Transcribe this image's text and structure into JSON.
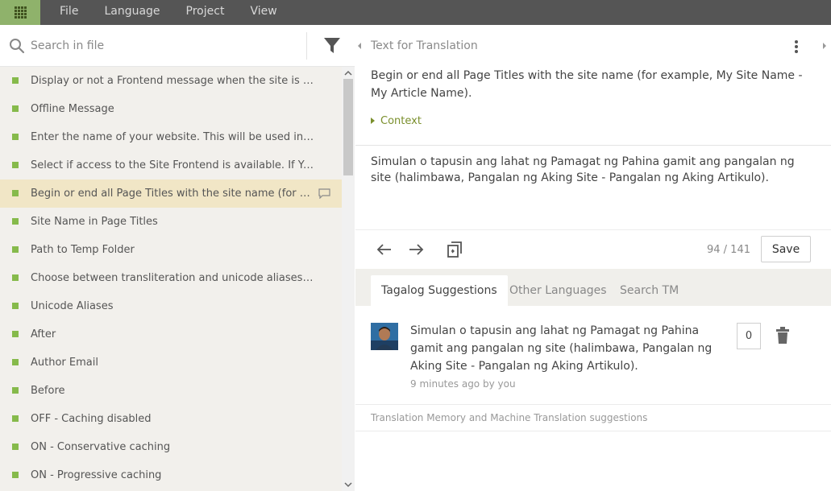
{
  "menubar": {
    "items": [
      "File",
      "Language",
      "Project",
      "View"
    ],
    "accent": "#8fb26b"
  },
  "search": {
    "placeholder": "Search in file"
  },
  "strings": [
    {
      "text": "Display or not a Frontend message when the site is offline. ...",
      "status": "translated",
      "selected": false
    },
    {
      "text": "Offline Message",
      "status": "translated",
      "selected": false
    },
    {
      "text": "Enter the name of your website. This will be used in various ...",
      "status": "translated",
      "selected": false
    },
    {
      "text": "Select if access to the Site Frontend is available. If Yes, the Fr...",
      "status": "translated",
      "selected": false
    },
    {
      "text": "Begin or end all Page Titles with the site name (for exam...",
      "status": "translated",
      "selected": true
    },
    {
      "text": "Site Name in Page Titles",
      "status": "translated",
      "selected": false
    },
    {
      "text": "Path to Temp Folder",
      "status": "translated",
      "selected": false
    },
    {
      "text": "Choose between transliteration and unicode aliases. Transli...",
      "status": "translated",
      "selected": false
    },
    {
      "text": "Unicode Aliases",
      "status": "translated",
      "selected": false
    },
    {
      "text": "After",
      "status": "translated",
      "selected": false
    },
    {
      "text": "Author Email",
      "status": "translated",
      "selected": false
    },
    {
      "text": "Before",
      "status": "translated",
      "selected": false
    },
    {
      "text": "OFF - Caching disabled",
      "status": "translated",
      "selected": false
    },
    {
      "text": "ON - Conservative caching",
      "status": "translated",
      "selected": false
    },
    {
      "text": "ON - Progressive caching",
      "status": "translated",
      "selected": false
    }
  ],
  "editor": {
    "source_title": "Text for Translation",
    "source_text": "Begin or end all Page Titles with the site name (for example, My Site Name - My Article Name).",
    "context_label": "Context",
    "translation": "Simulan o tapusin ang lahat ng Pamagat ng Pahina gamit ang pangalan ng site (halimbawa, Pangalan ng Aking Site - Pangalan ng Aking Artikulo).",
    "counter": "94 / 141",
    "save_label": "Save"
  },
  "tabs": [
    "Tagalog Suggestions",
    "Other Languages",
    "Search TM"
  ],
  "suggestion": {
    "text": "Simulan o tapusin ang lahat ng Pamagat ng Pahina gamit ang pangalan ng site (halimbawa, Pangalan ng Aking Site - Pangalan ng Aking Artikulo).",
    "meta": "9 minutes ago by you",
    "votes": "0"
  },
  "tm_label": "Translation Memory and Machine Translation suggestions",
  "colors": {
    "translated_dot": "#86ba4b",
    "selected_row": "#f1e6c6",
    "context": "#7a8f2c"
  }
}
